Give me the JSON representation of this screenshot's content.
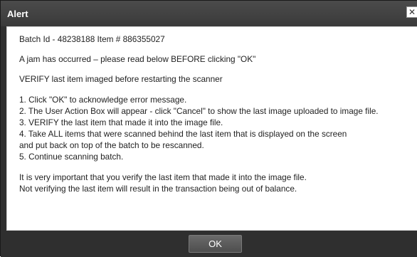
{
  "dialog": {
    "title": "Alert",
    "close_glyph": "✕",
    "close_icon": "close-icon"
  },
  "message": {
    "batch_line": "Batch Id - 48238188 Item # 886355027",
    "warning": "A jam has occurred – please read below BEFORE clicking \"OK\"",
    "verify": "VERIFY last item imaged before restarting the scanner",
    "steps": [
      "1. Click \"OK\" to acknowledge error message.",
      "2. The User Action Box will appear - click \"Cancel\" to show the last image uploaded to image file.",
      "3. VERIFY the last item that made it into the image file.",
      "4. Take ALL items that were scanned behind the last item that is displayed on the screen",
      "and put back on top of the batch to be rescanned.",
      "5. Continue scanning batch."
    ],
    "important": [
      "It is very important that you verify the last item that made it into the image file.",
      "Not verifying the last item will result in the transaction being out of balance."
    ]
  },
  "buttons": {
    "ok_label": "OK"
  },
  "colors": {
    "frame": "#2f2f2f",
    "content_bg": "#ffffff"
  }
}
